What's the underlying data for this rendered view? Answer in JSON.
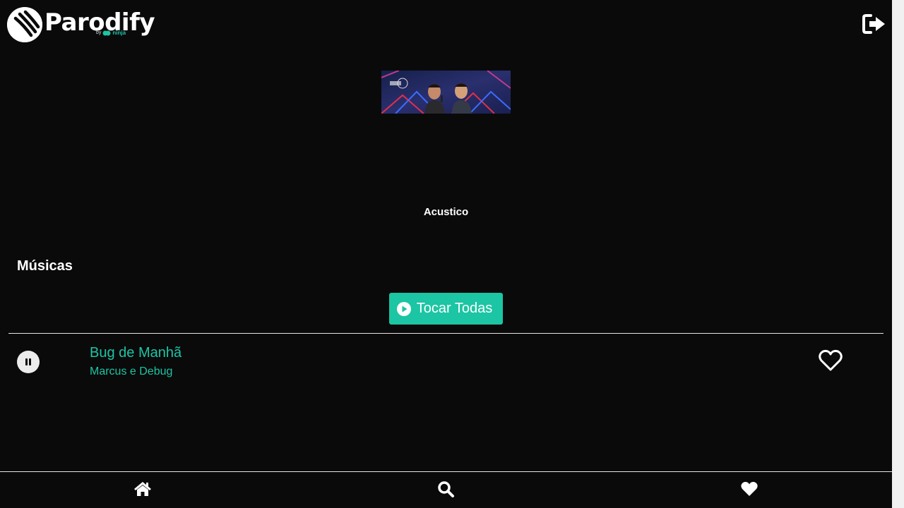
{
  "header": {
    "logo_text": "Parodify",
    "logo_by": "by",
    "logo_brand": "ninja",
    "logout_icon": "sign-out-icon"
  },
  "album": {
    "title": "Acustico",
    "cover_alt": "Acustico"
  },
  "songs_section": {
    "title": "Músicas",
    "play_all_label": "Tocar Todas",
    "play_all_icon": "play-circle-icon"
  },
  "tracks": [
    {
      "title": "Bug de Manhã",
      "artist": "Marcus e Debug",
      "state_icon": "pause-icon",
      "favorite_icon": "heart-outline-icon"
    }
  ],
  "bottom_nav": {
    "items": [
      {
        "icon": "home-icon"
      },
      {
        "icon": "search-icon"
      },
      {
        "icon": "heart-icon"
      }
    ]
  },
  "colors": {
    "background": "#0a0a0b",
    "accent": "#1cc5a3",
    "text": "#ffffff"
  }
}
